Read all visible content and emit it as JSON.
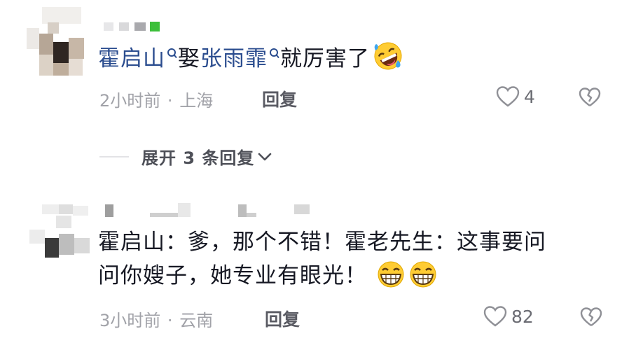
{
  "comments": [
    {
      "username": "",
      "content": {
        "mention1": "霍启山",
        "verb": "娶",
        "mention2": "张雨霏",
        "tail": "就厉害了",
        "emoji": "rolling-on-floor-laughing-emoji"
      },
      "time": "2小时前",
      "separator": "·",
      "location": "上海",
      "reply_label": "回复",
      "likes": "4"
    },
    {
      "username": "",
      "content": {
        "line1": "霍启山：爹，那个不错！霍老先生：这事要问",
        "line2": "问你嫂子，她专业有眼光！",
        "emoji": "grinning-face-emoji"
      },
      "time": "3小时前",
      "separator": "·",
      "location": "云南",
      "reply_label": "回复",
      "likes": "82"
    }
  ],
  "expand_replies": {
    "label": "展开 3 条回复",
    "icon": "chevron-down-icon"
  },
  "colors": {
    "mention": "#2b4d8f",
    "text": "#161823",
    "meta": "#a1a2a8"
  }
}
